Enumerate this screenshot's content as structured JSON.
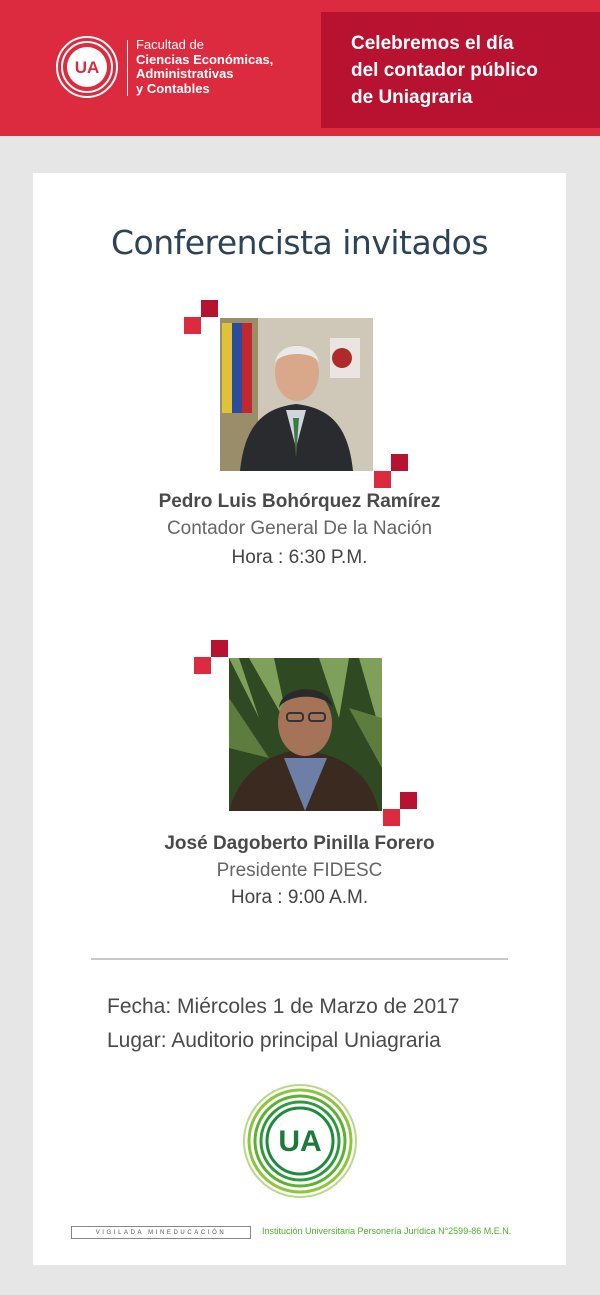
{
  "header": {
    "faculty_line1": "Facultad de",
    "faculty_line2": "Ciencias Económicas,",
    "faculty_line3": "Administrativas",
    "faculty_line4": "y Contables",
    "logo_text": "UA",
    "title_line1": "Celebremos el día",
    "title_line2": "del contador público",
    "title_line3": "de Uniagraria"
  },
  "main": {
    "section_title": "Conferencista invitados"
  },
  "speakers": [
    {
      "name": "Pedro Luis Bohórquez Ramírez",
      "role": "Contador General De la Nación",
      "time": "Hora : 6:30 P.M."
    },
    {
      "name": "José Dagoberto Pinilla Forero",
      "role": "Presidente FIDESC",
      "time": "Hora : 9:00 A.M."
    }
  ],
  "event": {
    "date": "Fecha: Miércoles 1 de Marzo de 2017",
    "place": "Lugar: Auditorio principal Uniagraria"
  },
  "footer": {
    "logo_text": "UA",
    "vigilada": "VIGILADA MINEDUCACIÓN",
    "institution": "Institución Universitaria Personería Jurídica N°2599-86 M.E.N."
  },
  "colors": {
    "header_red": "#dc2a3e",
    "header_dark_red": "#b81231",
    "green": "#4bb22a",
    "title_blue": "#2c4456"
  }
}
